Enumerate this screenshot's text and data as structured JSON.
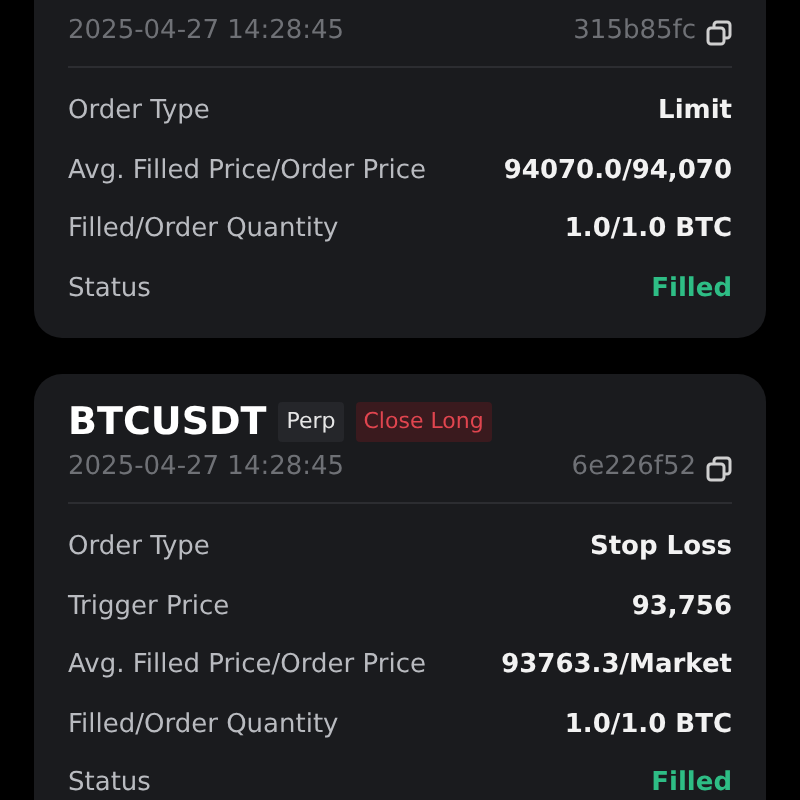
{
  "orders": [
    {
      "cut_top": true,
      "time": "2025-04-27 14:28:45",
      "order_id": "315b85fc",
      "rows": [
        {
          "label": "Order Type",
          "value": "Limit",
          "kind": "plain"
        },
        {
          "label": "Avg. Filled Price/Order Price",
          "value": "94070.0/94,070",
          "kind": "plain"
        },
        {
          "label": "Filled/Order Quantity",
          "value": "1.0/1.0 BTC",
          "kind": "plain"
        },
        {
          "label": "Status",
          "value": "Filled",
          "kind": "status"
        }
      ]
    },
    {
      "cut_top": false,
      "symbol": "BTCUSDT",
      "tags": [
        {
          "text": "Perp",
          "kind": "plain"
        },
        {
          "text": "Close Long",
          "kind": "sell"
        }
      ],
      "time": "2025-04-27 14:28:45",
      "order_id": "6e226f52",
      "rows": [
        {
          "label": "Order Type",
          "value": "Stop Loss",
          "kind": "plain"
        },
        {
          "label": "Trigger Price",
          "value": "93,756",
          "kind": "plain"
        },
        {
          "label": "Avg. Filled Price/Order Price",
          "value": "93763.3/Market",
          "kind": "plain"
        },
        {
          "label": "Filled/Order Quantity",
          "value": "1.0/1.0 BTC",
          "kind": "plain"
        },
        {
          "label": "Status",
          "value": "Filled",
          "kind": "status"
        }
      ]
    }
  ]
}
